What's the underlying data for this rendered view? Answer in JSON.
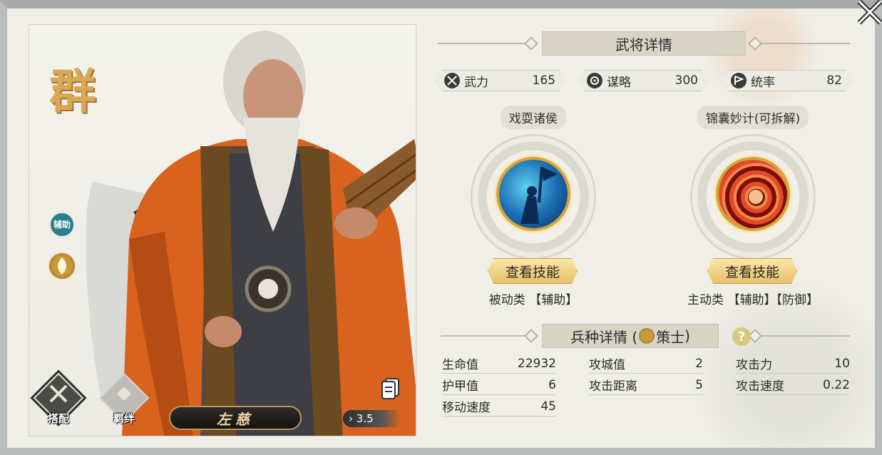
{
  "hero": {
    "faction": "群",
    "role_badge": "辅助",
    "name": "左慈",
    "cost": "3.5",
    "equip_label": "搭配",
    "bond_label": "羁绊"
  },
  "details_title": "武将详情",
  "stats": [
    {
      "icon": "crossed-swords-icon",
      "label": "武力",
      "value": "165"
    },
    {
      "icon": "strategy-icon",
      "label": "谋略",
      "value": "300"
    },
    {
      "icon": "command-flag-icon",
      "label": "统率",
      "value": "82"
    }
  ],
  "skills": [
    {
      "name": "戏耍诸侯",
      "button": "查看技能",
      "tags": "被动类 【辅助】"
    },
    {
      "name": "锦囊妙计(可拆解)",
      "button": "查看技能",
      "tags": "主动类 【辅助】【防御】"
    }
  ],
  "troop": {
    "title_prefix": "兵种详情 (",
    "type": "策士",
    "title_suffix": ")",
    "help": "?",
    "stats": [
      {
        "label": "生命值",
        "value": "22932"
      },
      {
        "label": "攻城值",
        "value": "2"
      },
      {
        "label": "攻击力",
        "value": "10"
      },
      {
        "label": "护甲值",
        "value": "6"
      },
      {
        "label": "攻击距离",
        "value": "5"
      },
      {
        "label": "攻击速度",
        "value": "0.22"
      },
      {
        "label": "移动速度",
        "value": "45"
      }
    ]
  },
  "colors": {
    "gold": "#e8c06a",
    "panel_bg": "#efeee7",
    "robe_orange": "#d8621e"
  }
}
